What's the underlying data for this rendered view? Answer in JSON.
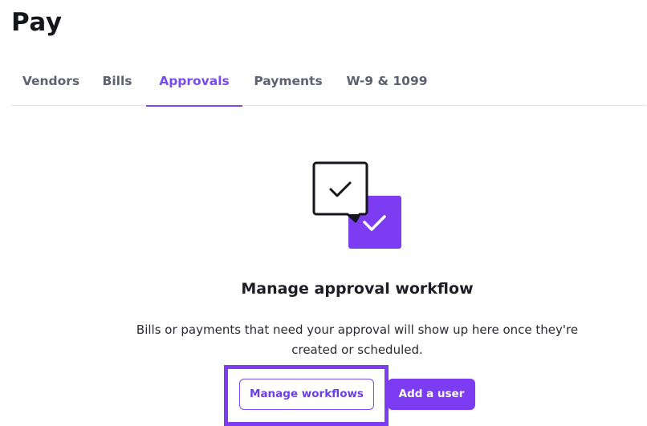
{
  "page": {
    "title": "Pay"
  },
  "tabs": [
    {
      "label": "Vendors",
      "active": false
    },
    {
      "label": "Bills",
      "active": false
    },
    {
      "label": "Approvals",
      "active": true
    },
    {
      "label": "Payments",
      "active": false
    },
    {
      "label": "W-9 & 1099",
      "active": false
    }
  ],
  "empty_state": {
    "illustration_icon": "approval-checkboxes-icon",
    "title": "Manage approval workflow",
    "description": "Bills or payments that need your approval will show up here once they're created or scheduled."
  },
  "actions": {
    "manage_workflows_label": "Manage workflows",
    "add_user_label": "Add a user"
  },
  "colors": {
    "accent": "#7b3cf2",
    "tab_inactive": "#5d6172",
    "highlight": "#7b3cf2"
  }
}
